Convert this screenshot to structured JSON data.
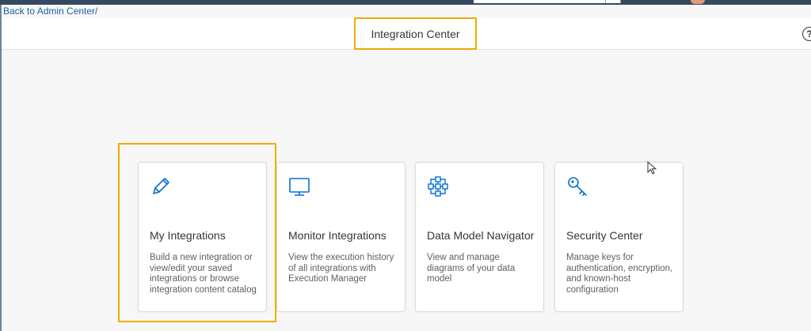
{
  "nav": {
    "back_link": "Back to Admin Center/"
  },
  "header": {
    "title": "Integration Center",
    "help_symbol": "?"
  },
  "cards": [
    {
      "icon": "pencil-icon",
      "title": "My Integrations",
      "description": "Build a new integration or view/edit your saved integrations or browse integration content catalog"
    },
    {
      "icon": "monitor-icon",
      "title": "Monitor Integrations",
      "description": "View the execution history of all integrations with Execution Manager"
    },
    {
      "icon": "network-icon",
      "title": "Data Model Navigator",
      "description": "View and manage diagrams of your data model"
    },
    {
      "icon": "key-icon",
      "title": "Security Center",
      "description": "Manage keys for authentication, encryption, and known-host configuration"
    }
  ],
  "colors": {
    "accent": "#0a6ed1",
    "highlight": "#f0ab00",
    "link": "#1f5f9e",
    "text": "#32363a"
  }
}
